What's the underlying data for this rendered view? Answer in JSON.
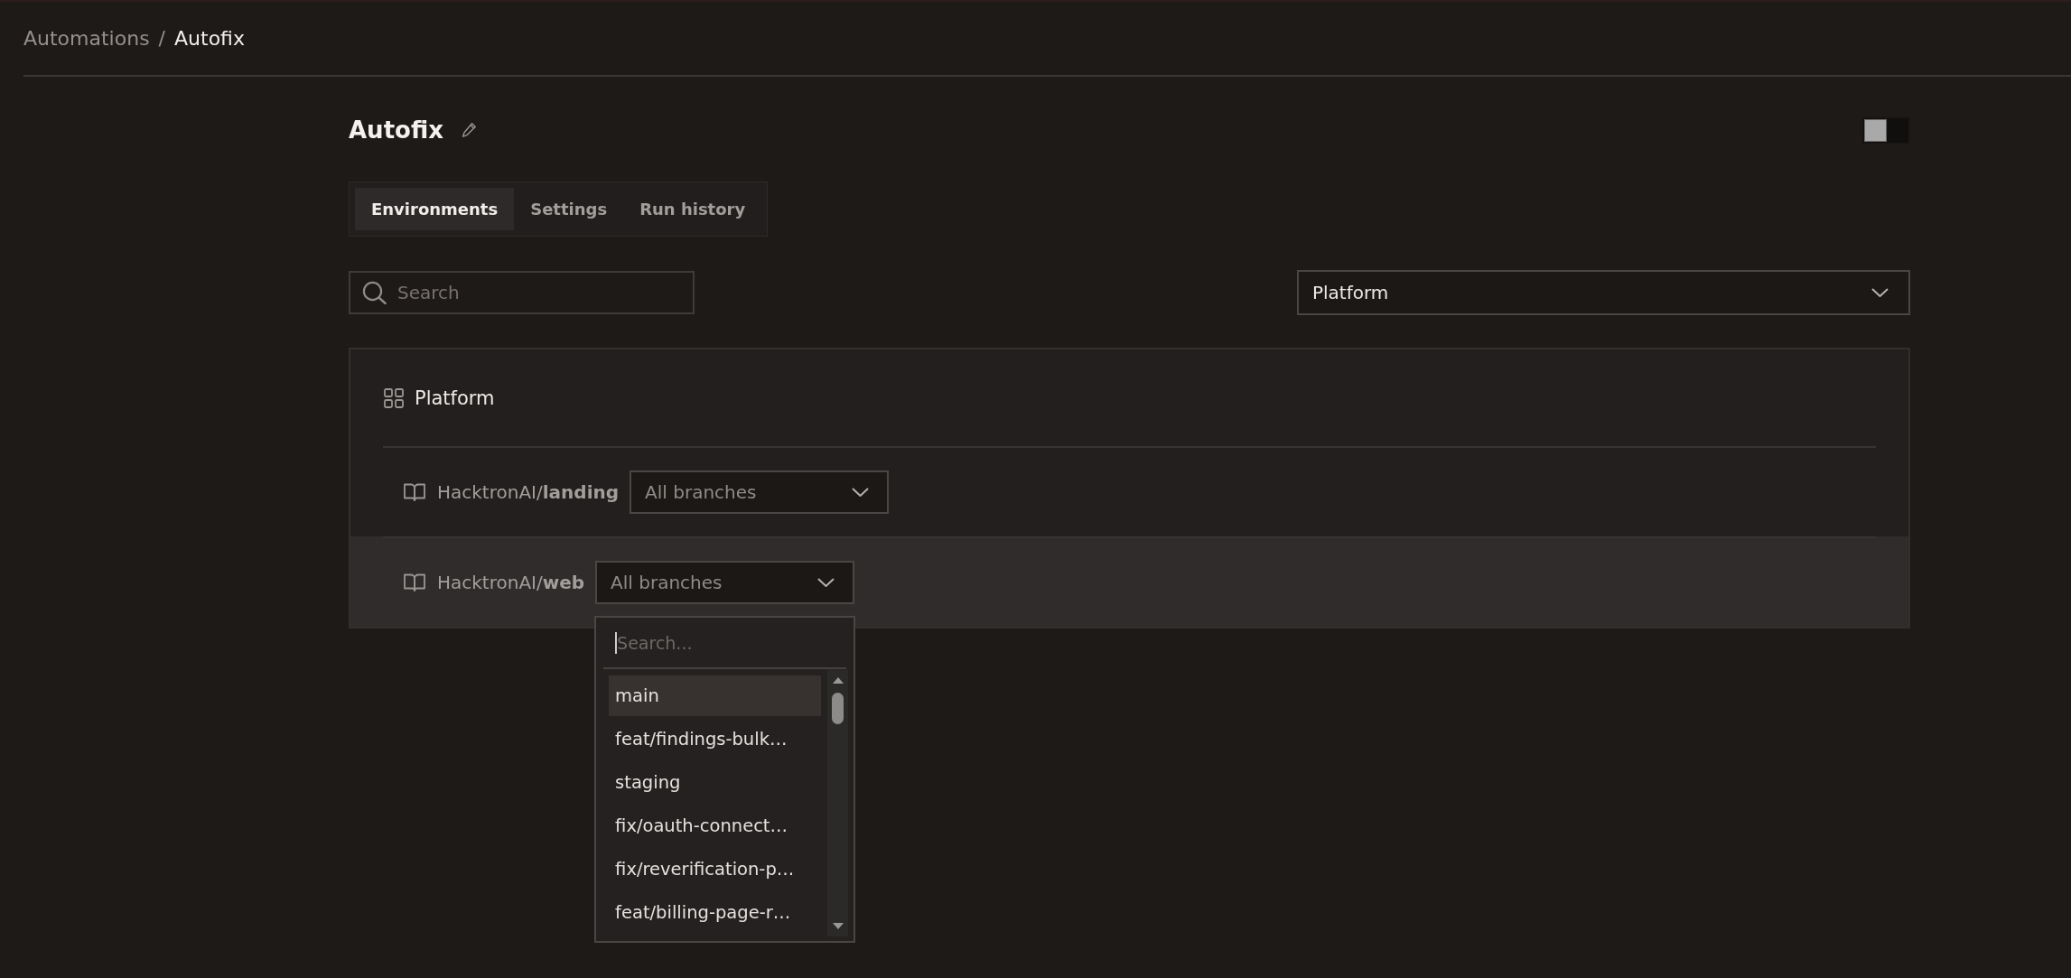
{
  "breadcrumb": {
    "separator": "/",
    "items": [
      {
        "label": "Automations",
        "current": false
      },
      {
        "label": "Autofix",
        "current": true
      }
    ]
  },
  "header": {
    "title": "Autofix",
    "toggle": {
      "on": false
    }
  },
  "tabs": [
    {
      "label": "Environments",
      "selected": true
    },
    {
      "label": "Settings",
      "selected": false
    },
    {
      "label": "Run history",
      "selected": false
    }
  ],
  "filters": {
    "search": {
      "placeholder": "Search"
    },
    "platform_select": {
      "value": "Platform"
    }
  },
  "group": {
    "name": "Platform",
    "repos": [
      {
        "repo": "HacktronAI/**landing**",
        "active": false,
        "branch_select": {
          "placeholder": "All branches"
        }
      },
      {
        "repo": "HacktronAI/**web**",
        "active": true,
        "branch_select": {
          "placeholder": "All branches",
          "menu": {
            "search": {
              "placeholder": "Search...",
              "focused": true
            },
            "items": [
              {
                "label": "main",
                "selected": true
              },
              {
                "label": "feat/findings-bulk…",
                "selected": false
              },
              {
                "label": "staging",
                "selected": false
              },
              {
                "label": "fix/oauth-connect…",
                "selected": false
              },
              {
                "label": "fix/reverification-p…",
                "selected": false
              },
              {
                "label": "feat/billing-page-r…",
                "selected": false
              }
            ]
          }
        }
      }
    ]
  }
}
